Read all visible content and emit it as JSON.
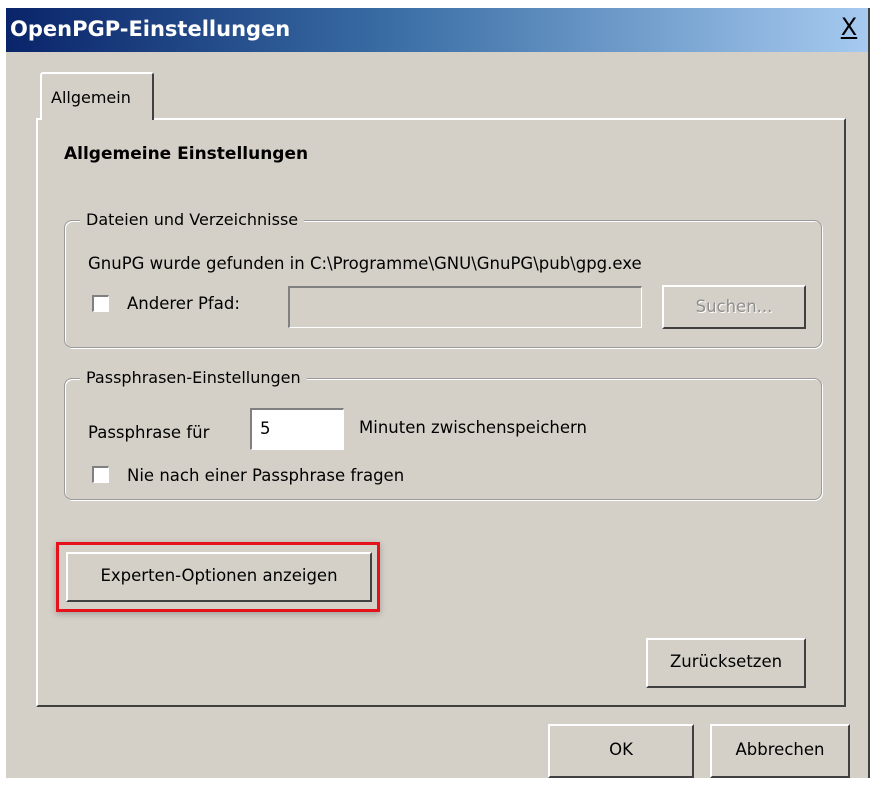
{
  "window": {
    "title": "OpenPGP-Einstellungen",
    "close_label": "X"
  },
  "tabs": [
    {
      "label": "Allgemein"
    }
  ],
  "section": {
    "heading": "Allgemeine Einstellungen"
  },
  "files_group": {
    "legend": "Dateien und Verzeichnisse",
    "found_text": "GnuPG wurde gefunden in C:\\Programme\\GNU\\GnuPG\\pub\\gpg.exe",
    "other_path_label": "Anderer Pfad:",
    "other_path_checked": false,
    "other_path_value": "",
    "search_button": "Suchen..."
  },
  "passphrase_group": {
    "legend": "Passphrasen-Einstellungen",
    "prefix": "Passphrase für",
    "minutes_value": "5",
    "suffix": "Minuten zwischenspeichern",
    "never_ask_label": "Nie nach einer Passphrase fragen",
    "never_ask_checked": false
  },
  "buttons": {
    "expert": "Experten-Optionen anzeigen",
    "reset": "Zurücksetzen",
    "ok": "OK",
    "cancel": "Abbrechen"
  },
  "colors": {
    "highlight": "#e5121c",
    "titlebar_start": "#0a246a",
    "dialog_bg": "#d4d0c8"
  }
}
